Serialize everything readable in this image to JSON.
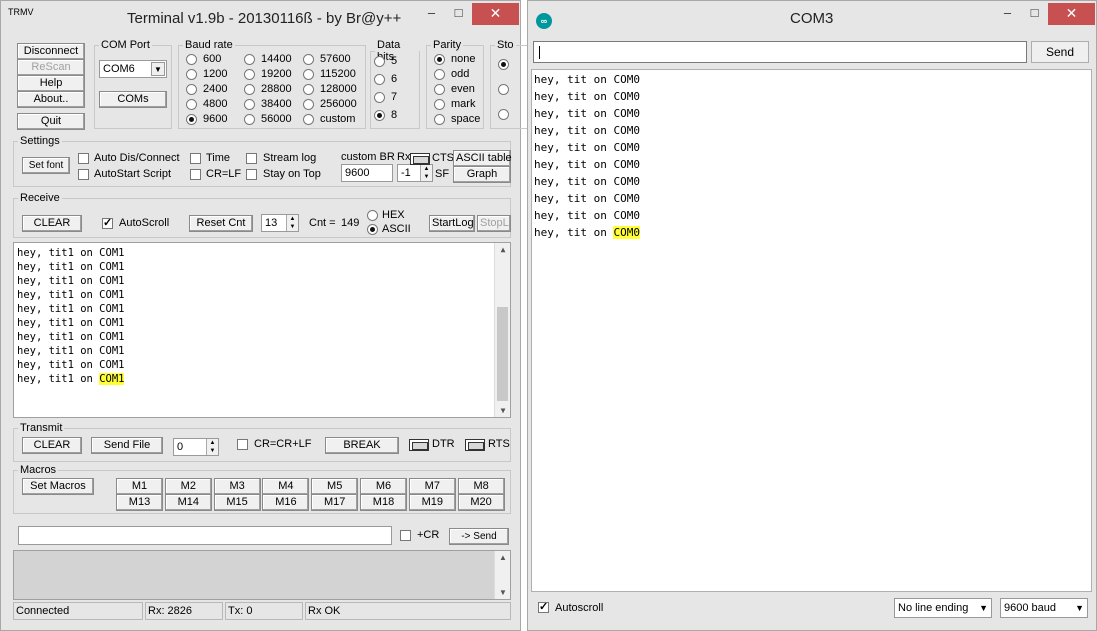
{
  "left": {
    "title": "Terminal v1.9b - 20130116ß - by Br@y++",
    "app_icon_label": "TRMV",
    "window_buttons": {
      "min": "–",
      "max": "□",
      "close": "✕"
    },
    "buttons": {
      "disconnect": "Disconnect",
      "rescan": "ReScan",
      "help": "Help",
      "about": "About..",
      "quit": "Quit",
      "coms": "COMs",
      "set_font": "Set font",
      "ascii_table": "ASCII table",
      "graph": "Graph",
      "clear_rx": "CLEAR",
      "reset_cnt": "Reset Cnt",
      "start_log": "StartLog",
      "stop_log": "StopLog",
      "clear_tx": "CLEAR",
      "send_file": "Send File",
      "break": "BREAK",
      "set_macros": "Set Macros",
      "send": "-> Send"
    },
    "com_port": {
      "legend": "COM Port",
      "value": "COM6"
    },
    "baud": {
      "legend": "Baud rate",
      "options": [
        "600",
        "1200",
        "2400",
        "4800",
        "9600",
        "14400",
        "19200",
        "28800",
        "38400",
        "56000",
        "57600",
        "115200",
        "128000",
        "256000",
        "custom"
      ],
      "selected": "9600"
    },
    "data_bits": {
      "legend": "Data bits",
      "options": [
        "5",
        "6",
        "7",
        "8"
      ],
      "selected": "8"
    },
    "parity": {
      "legend": "Parity",
      "options": [
        "none",
        "odd",
        "even",
        "mark",
        "space"
      ],
      "selected": "none"
    },
    "stop": {
      "legend": "Sto"
    },
    "settings": {
      "legend": "Settings",
      "auto_dis_connect": "Auto Dis/Connect",
      "autostart_script": "AutoStart Script",
      "time": "Time",
      "cr_lf": "CR=LF",
      "stream_log": "Stream log",
      "stay_on_top": "Stay on Top",
      "custom_br_label": "custom BR",
      "custom_br_value": "9600",
      "rx_label": "Rx",
      "rx_value": "-1",
      "cts": "CTS",
      "sf": "SF"
    },
    "receive": {
      "legend": "Receive",
      "autoscroll": "AutoScroll",
      "spin_value": "13",
      "cnt_label": "Cnt =",
      "cnt_value": "149",
      "hex": "HEX",
      "ascii": "ASCII",
      "lines": [
        "hey, tit1 on COM1",
        "hey, tit1 on COM1",
        "hey, tit1 on COM1",
        "hey, tit1 on COM1",
        "hey, tit1 on COM1",
        "hey, tit1 on COM1",
        "hey, tit1 on COM1",
        "hey, tit1 on COM1",
        "hey, tit1 on COM1"
      ],
      "last_prefix": "hey, tit1 on ",
      "last_highlight": "COM1"
    },
    "transmit": {
      "legend": "Transmit",
      "spin_value": "0",
      "cr_cr_lf": "CR=CR+LF",
      "dtr": "DTR",
      "rts": "RTS"
    },
    "macros": {
      "legend": "Macros",
      "row1": [
        "M1",
        "M2",
        "M3",
        "M4",
        "M5",
        "M6",
        "M7",
        "M8"
      ],
      "row2": [
        "M13",
        "M14",
        "M15",
        "M16",
        "M17",
        "M18",
        "M19",
        "M20"
      ]
    },
    "send_bar": {
      "cr": "+CR"
    },
    "status": {
      "connected": "Connected",
      "rx": "Rx: 2826",
      "tx": "Tx: 0",
      "rx_ok": "Rx OK"
    }
  },
  "right": {
    "title": "COM3",
    "window_buttons": {
      "min": "–",
      "max": "□",
      "close": "✕"
    },
    "send_label": "Send",
    "lines": [
      "hey, tit on COM0",
      "hey, tit on COM0",
      "hey, tit on COM0",
      "hey, tit on COM0",
      "hey, tit on COM0",
      "hey, tit on COM0",
      "hey, tit on COM0",
      "hey, tit on COM0",
      "hey, tit on COM0"
    ],
    "last_prefix": "hey, tit on ",
    "last_highlight": "COM0",
    "autoscroll": "Autoscroll",
    "line_ending": "No line ending",
    "baud": "9600 baud"
  },
  "colors": {
    "highlight": "#ffff33",
    "close_button": "#c75050",
    "arduino_teal": "#00979c"
  }
}
